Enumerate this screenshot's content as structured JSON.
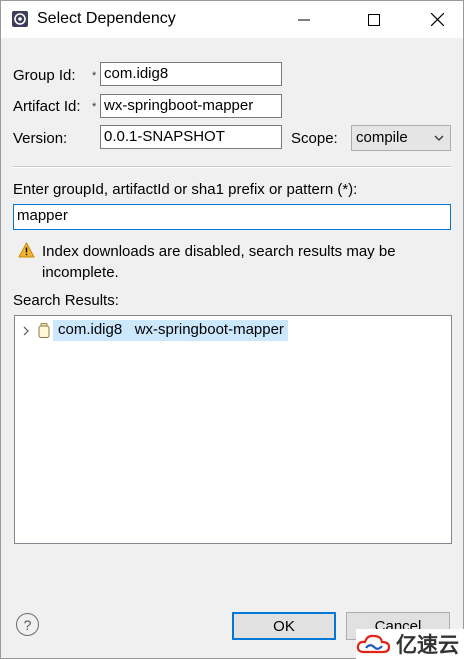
{
  "window": {
    "title": "Select Dependency"
  },
  "form": {
    "group_label": "Group Id:",
    "group_value": "com.idig8",
    "artifact_label": "Artifact Id:",
    "artifact_value": "wx-springboot-mapper",
    "version_label": "Version:",
    "version_value": "0.0.1-SNAPSHOT",
    "scope_label": "Scope:",
    "scope_value": "compile",
    "required_marker": "*"
  },
  "search": {
    "prompt": "Enter groupId, artifactId or sha1 prefix or pattern (*):",
    "query": "mapper"
  },
  "warning": {
    "text": "Index downloads are disabled, search results may be incomplete."
  },
  "results": {
    "label": "Search Results:",
    "items": [
      {
        "label": "com.idig8   wx-springboot-mapper"
      }
    ]
  },
  "buttons": {
    "ok": "OK",
    "cancel": "Cancel"
  },
  "help": {
    "symbol": "?"
  },
  "watermark": {
    "text": "亿速云"
  },
  "colors": {
    "selection": "#cce8ff",
    "focus_border": "#0078d7",
    "warning": "#f2b233"
  }
}
